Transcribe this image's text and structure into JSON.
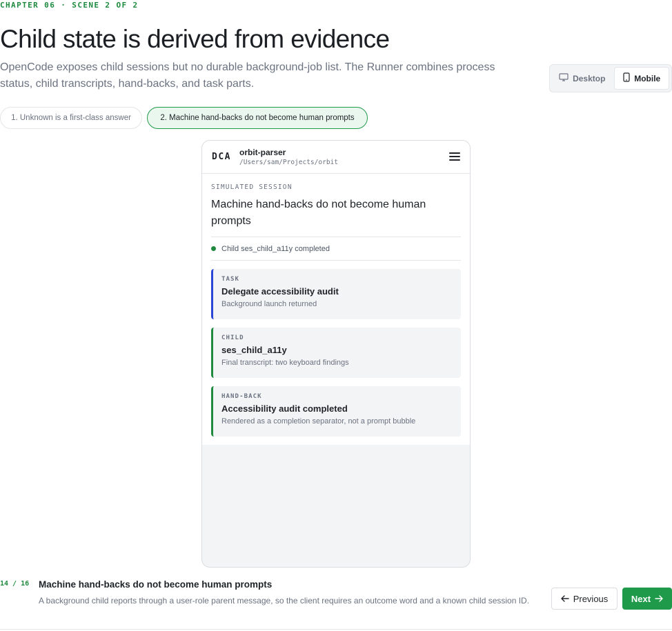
{
  "header": {
    "eyebrow": "CHAPTER 06 · SCENE 2 OF 2",
    "title": "Child state is derived from evidence",
    "subtitle": "OpenCode exposes child sessions but no durable background-job list. The Runner combines process status, child transcripts, hand-backs, and task parts."
  },
  "view_toggle": {
    "desktop_label": "Desktop",
    "mobile_label": "Mobile",
    "selected": "Mobile"
  },
  "scenes": [
    {
      "label": "1. Unknown is a first-class answer",
      "active": false
    },
    {
      "label": "2. Machine hand-backs do not become human prompts",
      "active": true
    }
  ],
  "phone": {
    "logo": "DCA",
    "project_name": "orbit-parser",
    "project_path": "/Users/sam/Projects/orbit",
    "session_label": "SIMULATED SESSION",
    "session_title": "Machine hand-backs do not become human prompts",
    "status_text": "Child ses_child_a11y completed",
    "cards": [
      {
        "kicker": "TASK",
        "title": "Delegate accessibility audit",
        "sub": "Background launch returned",
        "accent": "#2b45d6"
      },
      {
        "kicker": "CHILD",
        "title": "ses_child_a11y",
        "sub": "Final transcript: two keyboard findings",
        "accent": "#1f8a3f"
      },
      {
        "kicker": "HAND-BACK",
        "title": "Accessibility audit completed",
        "sub": "Rendered as a completion separator, not a prompt bubble",
        "accent": "#1f8a3f"
      }
    ]
  },
  "footer": {
    "counter": "14 / 16",
    "title": "Machine hand-backs do not become human prompts",
    "description": "A background child reports through a user-role parent message, so the client requires an outcome word and a known child session ID.",
    "prev_label": "Previous",
    "next_label": "Next"
  },
  "colors": {
    "accent": "#1f8a3f",
    "primary_button": "#1f9a4a",
    "task_accent": "#2b45d6"
  }
}
